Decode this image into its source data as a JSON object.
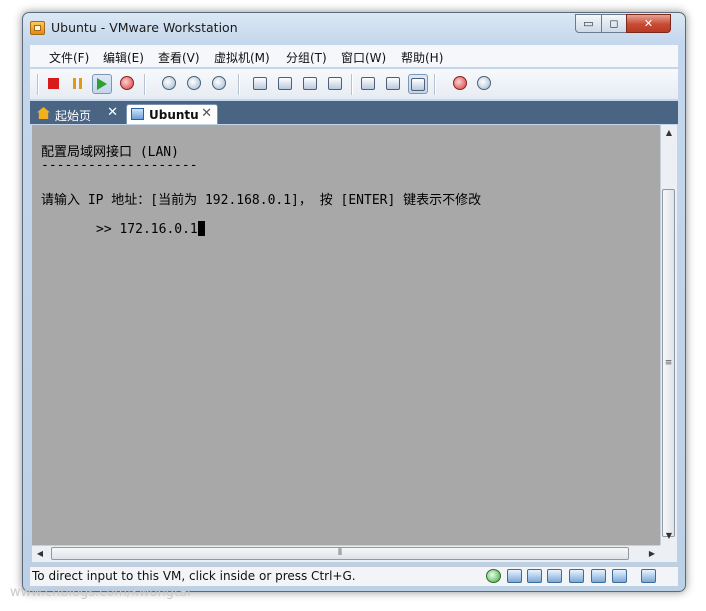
{
  "window": {
    "title": "Ubuntu - VMware Workstation"
  },
  "titlebar_buttons": {
    "minimize": "▭",
    "maximize": "◻",
    "close": "✕"
  },
  "menu": [
    "文件(F)",
    "编辑(E)",
    "查看(V)",
    "虚拟机(M)",
    "分组(T)",
    "窗口(W)",
    "帮助(H)"
  ],
  "tabs": [
    {
      "label": "起始页",
      "icon": "home-icon",
      "close": "✕"
    },
    {
      "label": "Ubuntu",
      "icon": "vm-icon",
      "close": "✕"
    }
  ],
  "console": {
    "heading": "配置局域网接口 (LAN)",
    "underline": "--------------------",
    "prompt": "请输入 IP 地址：[当前为 192.168.0.1]， 按 [ENTER] 键表示不修改",
    "input": ">> 172.16.0.1"
  },
  "scrollbars": {
    "up": "▲",
    "down": "▼",
    "left": "◀",
    "right": "▶",
    "grip_v": "≡",
    "grip_h": "⦀"
  },
  "status": {
    "text": "To direct input to this VM, click inside or press Ctrl+G."
  },
  "watermark": "www.cnblogs.com/kwongtai"
}
